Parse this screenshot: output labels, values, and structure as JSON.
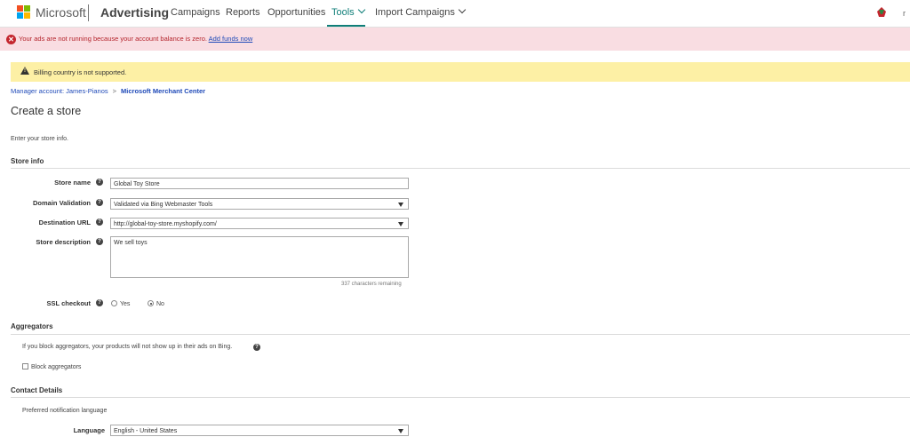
{
  "nav": {
    "brand": "Microsoft",
    "product": "Advertising",
    "items": [
      "Campaigns",
      "Reports",
      "Opportunities",
      "Tools",
      "Import Campaigns"
    ],
    "user_initial": "r"
  },
  "error_banner": {
    "text": "Your ads are not running because your account balance is zero.",
    "link": "Add funds now"
  },
  "warning_banner": {
    "text": "Billing country is not supported."
  },
  "breadcrumb": {
    "parent": "Manager account: James-Pianos",
    "separator": ">",
    "current": "Microsoft Merchant Center"
  },
  "page": {
    "title": "Create a store",
    "intro": "Enter your store info."
  },
  "store_info": {
    "heading": "Store info",
    "store_name_label": "Store name",
    "store_name_value": "Global Toy Store",
    "domain_label": "Domain Validation",
    "domain_value": "Validated via Bing Webmaster Tools",
    "url_label": "Destination URL",
    "url_value": "http://global-toy-store.myshopify.com/",
    "desc_label": "Store description",
    "desc_value": "We sell toys",
    "remaining": "337 characters remaining",
    "ssl_label": "SSL checkout",
    "ssl_yes": "Yes",
    "ssl_no": "No"
  },
  "aggregators": {
    "heading": "Aggregators",
    "note": "If you block aggregators, your products will not show up in their ads on Bing.",
    "checkbox_label": "Block aggregators"
  },
  "contact": {
    "heading": "Contact Details",
    "pref_text": "Preferred notification language",
    "language_label": "Language",
    "language_value": "English - United States"
  },
  "colors": {
    "accent": "#0f7e78",
    "error_bg": "#f9dde2",
    "warning_bg": "#fdf0a5",
    "link": "#1f4ab8"
  }
}
